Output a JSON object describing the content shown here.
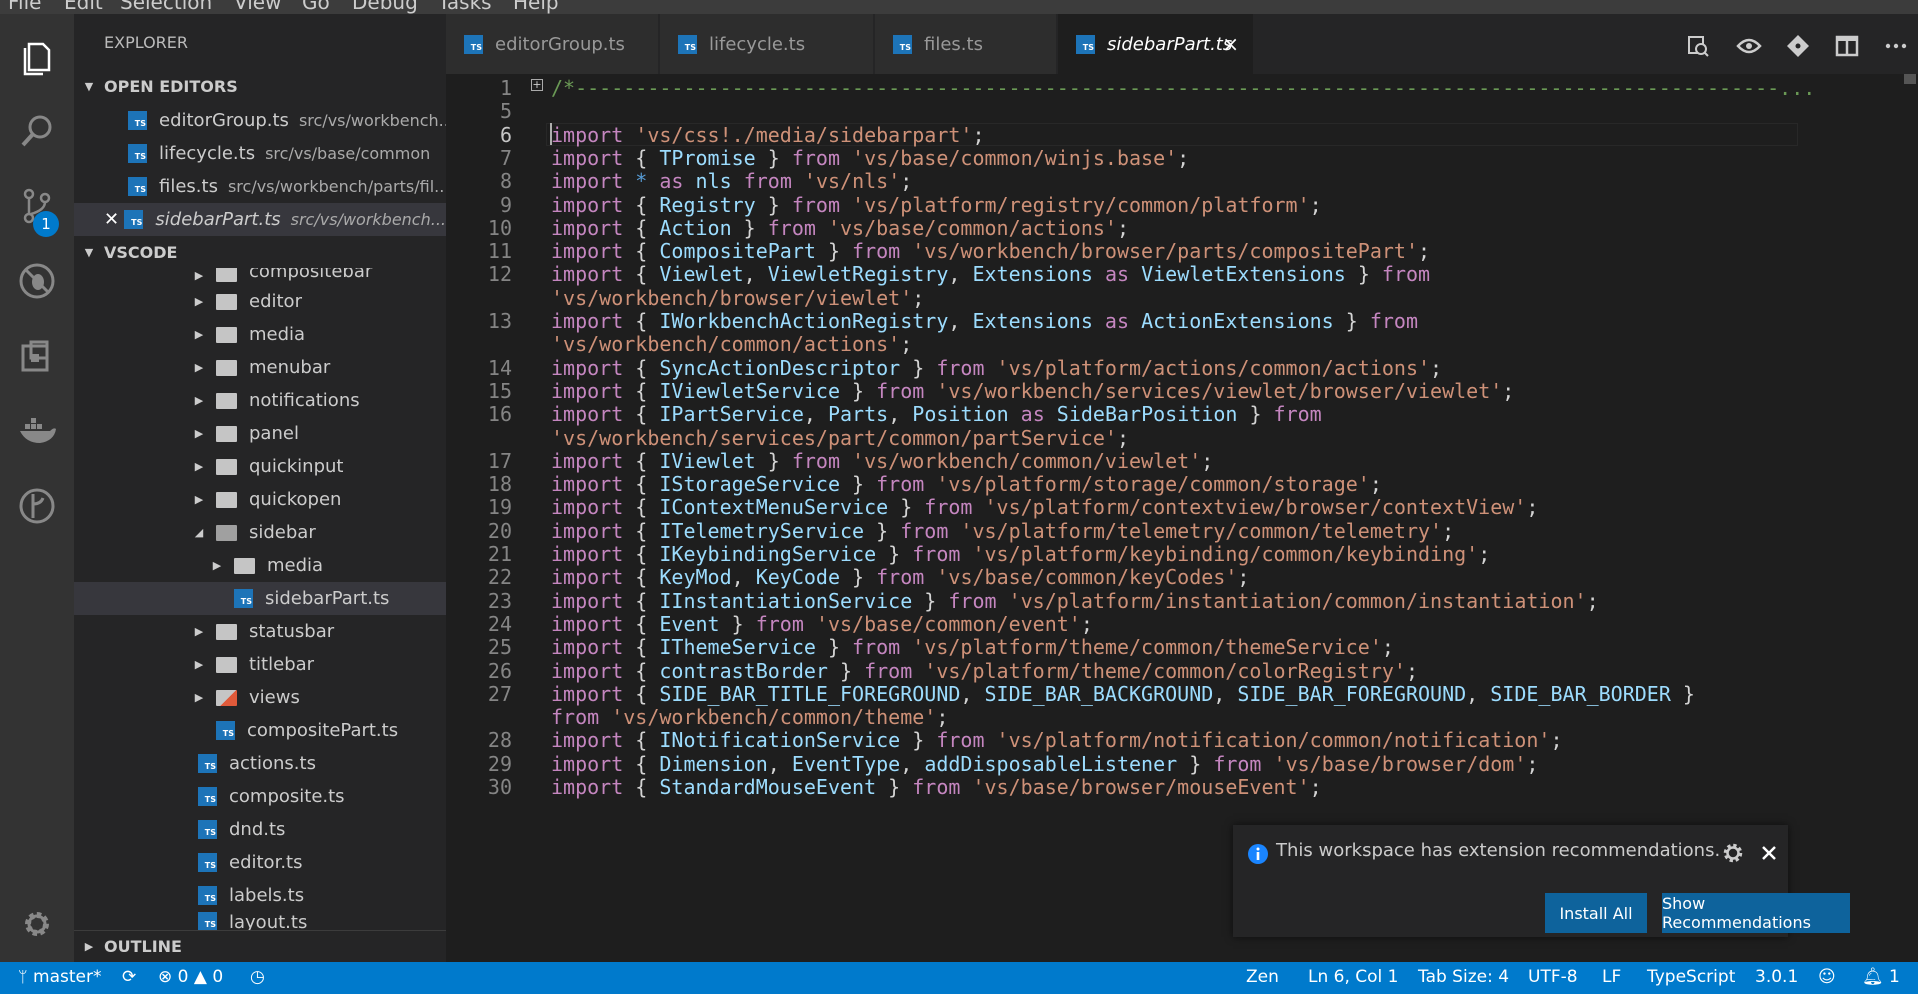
{
  "menubar": {
    "items": [
      "File",
      "Edit",
      "Selection",
      "View",
      "Go",
      "Debug",
      "Tasks",
      "Help"
    ]
  },
  "activity_bar": {
    "scm_badge": "1"
  },
  "sidebar": {
    "title": "EXPLORER",
    "open_editors_label": "OPEN EDITORS",
    "open_editors": [
      {
        "name": "editorGroup.ts",
        "path": "src/vs/workbench..."
      },
      {
        "name": "lifecycle.ts",
        "path": "src/vs/base/common"
      },
      {
        "name": "files.ts",
        "path": "src/vs/workbench/parts/fil..."
      },
      {
        "name": "sidebarPart.ts",
        "path": "src/vs/workbench..."
      }
    ],
    "workspace_label": "VSCODE",
    "tree": [
      {
        "name": "compositebar"
      },
      {
        "name": "editor"
      },
      {
        "name": "media"
      },
      {
        "name": "menubar"
      },
      {
        "name": "notifications"
      },
      {
        "name": "panel"
      },
      {
        "name": "quickinput"
      },
      {
        "name": "quickopen"
      },
      {
        "name": "sidebar"
      },
      {
        "name": "media"
      },
      {
        "name": "sidebarPart.ts"
      },
      {
        "name": "statusbar"
      },
      {
        "name": "titlebar"
      },
      {
        "name": "views"
      },
      {
        "name": "compositePart.ts"
      },
      {
        "name": "actions.ts"
      },
      {
        "name": "composite.ts"
      },
      {
        "name": "dnd.ts"
      },
      {
        "name": "editor.ts"
      },
      {
        "name": "labels.ts"
      },
      {
        "name": "layout.ts"
      }
    ],
    "outline_label": "OUTLINE"
  },
  "tabs": [
    {
      "label": "editorGroup.ts"
    },
    {
      "label": "lifecycle.ts"
    },
    {
      "label": "files.ts"
    },
    {
      "label": "sidebarPart.ts",
      "close": "×"
    }
  ],
  "editor": {
    "lines": [
      {
        "n": "1",
        "text": "/*----------------------------------------------------------------------------------------------------..."
      },
      {
        "n": "5",
        "text": ""
      },
      {
        "n": "6",
        "text": "import 'vs/css!./media/sidebarpart';"
      },
      {
        "n": "7",
        "text": "import { TPromise } from 'vs/base/common/winjs.base';"
      },
      {
        "n": "8",
        "text": "import * as nls from 'vs/nls';"
      },
      {
        "n": "9",
        "text": "import { Registry } from 'vs/platform/registry/common/platform';"
      },
      {
        "n": "10",
        "text": "import { Action } from 'vs/base/common/actions';"
      },
      {
        "n": "11",
        "text": "import { CompositePart } from 'vs/workbench/browser/parts/compositePart';"
      },
      {
        "n": "12",
        "text": "import { Viewlet, ViewletRegistry, Extensions as ViewletExtensions } from"
      },
      {
        "n": "",
        "text": "'vs/workbench/browser/viewlet';"
      },
      {
        "n": "13",
        "text": "import { IWorkbenchActionRegistry, Extensions as ActionExtensions } from"
      },
      {
        "n": "",
        "text": "'vs/workbench/common/actions';"
      },
      {
        "n": "14",
        "text": "import { SyncActionDescriptor } from 'vs/platform/actions/common/actions';"
      },
      {
        "n": "15",
        "text": "import { IViewletService } from 'vs/workbench/services/viewlet/browser/viewlet';"
      },
      {
        "n": "16",
        "text": "import { IPartService, Parts, Position as SideBarPosition } from"
      },
      {
        "n": "",
        "text": "'vs/workbench/services/part/common/partService';"
      },
      {
        "n": "17",
        "text": "import { IViewlet } from 'vs/workbench/common/viewlet';"
      },
      {
        "n": "18",
        "text": "import { IStorageService } from 'vs/platform/storage/common/storage';"
      },
      {
        "n": "19",
        "text": "import { IContextMenuService } from 'vs/platform/contextview/browser/contextView';"
      },
      {
        "n": "20",
        "text": "import { ITelemetryService } from 'vs/platform/telemetry/common/telemetry';"
      },
      {
        "n": "21",
        "text": "import { IKeybindingService } from 'vs/platform/keybinding/common/keybinding';"
      },
      {
        "n": "22",
        "text": "import { KeyMod, KeyCode } from 'vs/base/common/keyCodes';"
      },
      {
        "n": "23",
        "text": "import { IInstantiationService } from 'vs/platform/instantiation/common/instantiation';"
      },
      {
        "n": "24",
        "text": "import { Event } from 'vs/base/common/event';"
      },
      {
        "n": "25",
        "text": "import { IThemeService } from 'vs/platform/theme/common/themeService';"
      },
      {
        "n": "26",
        "text": "import { contrastBorder } from 'vs/platform/theme/common/colorRegistry';"
      },
      {
        "n": "27",
        "text": "import { SIDE_BAR_TITLE_FOREGROUND, SIDE_BAR_BACKGROUND, SIDE_BAR_FOREGROUND, SIDE_BAR_BORDER }"
      },
      {
        "n": "",
        "text": "from 'vs/workbench/common/theme';"
      },
      {
        "n": "28",
        "text": "import { INotificationService } from 'vs/platform/notification/common/notification';"
      },
      {
        "n": "29",
        "text": "import { Dimension, EventType, addDisposableListener } from 'vs/base/browser/dom';"
      },
      {
        "n": "30",
        "text": "import { StandardMouseEvent } from 'vs/base/browser/mouseEvent';"
      }
    ]
  },
  "notification": {
    "message": "This workspace has extension recommendations.",
    "install_all": "Install All",
    "show_recommendations": "Show Recommendations"
  },
  "statusbar": {
    "branch": "master*",
    "errors": "0",
    "warnings": "0",
    "zen": "Zen",
    "position": "Ln 6, Col 1",
    "tab_size": "Tab Size: 4",
    "encoding": "UTF-8",
    "eol": "LF",
    "language": "TypeScript",
    "version": "3.0.1",
    "bell_count": "1"
  },
  "colors": {
    "accent": "#007acc",
    "button": "#0e639c",
    "editor_bg": "#1e1e1e",
    "sidebar_bg": "#252526",
    "activity_bg": "#333333"
  }
}
